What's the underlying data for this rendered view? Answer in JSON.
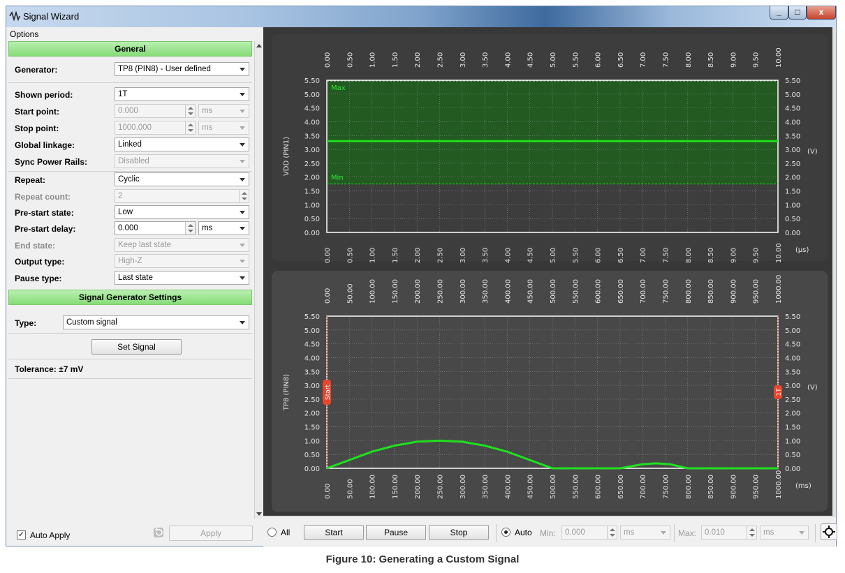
{
  "window": {
    "title": "Signal Wizard"
  },
  "menu": {
    "options": "Options"
  },
  "general": {
    "header": "General",
    "generator_label": "Generator:",
    "generator_value": "TP8 (PIN8) - User defined",
    "shown_period_label": "Shown period:",
    "shown_period_value": "1T",
    "start_point_label": "Start point:",
    "start_point_value": "0.000",
    "start_point_unit": "ms",
    "stop_point_label": "Stop point:",
    "stop_point_value": "1000.000",
    "stop_point_unit": "ms",
    "global_linkage_label": "Global linkage:",
    "global_linkage_value": "Linked",
    "sync_power_rails_label": "Sync Power Rails:",
    "sync_power_rails_value": "Disabled",
    "repeat_label": "Repeat:",
    "repeat_value": "Cyclic",
    "repeat_count_label": "Repeat count:",
    "repeat_count_value": "2",
    "prestart_state_label": "Pre-start state:",
    "prestart_state_value": "Low",
    "prestart_delay_label": "Pre-start delay:",
    "prestart_delay_value": "0.000",
    "prestart_delay_unit": "ms",
    "end_state_label": "End state:",
    "end_state_value": "Keep last state",
    "output_type_label": "Output type:",
    "output_type_value": "High-Z",
    "pause_type_label": "Pause type:",
    "pause_type_value": "Last state"
  },
  "sgs": {
    "header": "Signal Generator Settings",
    "type_label": "Type:",
    "type_value": "Custom signal",
    "set_signal": "Set Signal",
    "tolerance": "Tolerance: ±7 mV"
  },
  "bottom_left": {
    "auto_apply": "Auto Apply",
    "apply": "Apply",
    "check_mark": "✓"
  },
  "controls": {
    "all": "All",
    "start": "Start",
    "pause": "Pause",
    "stop": "Stop",
    "auto": "Auto",
    "min_label": "Min:",
    "min_value": "0.000",
    "min_unit": "ms",
    "max_label": "Max:",
    "max_value": "0.010",
    "max_unit": "ms"
  },
  "caption": "Figure 10: Generating a Custom Signal",
  "chart_data": [
    {
      "type": "line",
      "ylabel": "VDD (PIN1)",
      "yunit": "(V)",
      "xunit": "(µs)",
      "x_ticks": [
        "0.00",
        "0.50",
        "1.00",
        "1.50",
        "2.00",
        "2.50",
        "3.00",
        "3.50",
        "4.00",
        "4.50",
        "5.00",
        "5.50",
        "6.00",
        "6.50",
        "7.00",
        "7.50",
        "8.00",
        "8.50",
        "9.00",
        "9.50",
        "10.00"
      ],
      "y_ticks": [
        "0.00",
        "0.50",
        "1.00",
        "1.50",
        "2.00",
        "2.50",
        "3.00",
        "3.50",
        "4.00",
        "4.50",
        "5.00",
        "5.50"
      ],
      "xlim": [
        0,
        10
      ],
      "ylim": [
        0,
        5.5
      ],
      "max_label": "Max",
      "min_label": "Min",
      "max_value": 5.5,
      "min_value": 1.75,
      "series": [
        {
          "x": [
            0,
            10
          ],
          "y": [
            3.3,
            3.3
          ]
        }
      ],
      "colors": {
        "line": "#1fe01f",
        "band": "#1f5d1f"
      }
    },
    {
      "type": "line",
      "ylabel": "TP8 (PIN8)",
      "yunit": "(V)",
      "xunit": "(ms)",
      "x_ticks": [
        "0.00",
        "50.00",
        "100.00",
        "150.00",
        "200.00",
        "250.00",
        "300.00",
        "350.00",
        "400.00",
        "450.00",
        "500.00",
        "550.00",
        "600.00",
        "650.00",
        "700.00",
        "750.00",
        "800.00",
        "850.00",
        "900.00",
        "950.00",
        "1000.00"
      ],
      "y_ticks": [
        "0.00",
        "0.50",
        "1.00",
        "1.50",
        "2.00",
        "2.50",
        "3.00",
        "3.50",
        "4.00",
        "4.50",
        "5.00",
        "5.50"
      ],
      "xlim": [
        0,
        1000
      ],
      "ylim": [
        0,
        5.5
      ],
      "start_marker": "Start",
      "end_marker": "1T",
      "series": [
        {
          "x": [
            0,
            50,
            100,
            150,
            200,
            250,
            300,
            350,
            400,
            450,
            500,
            550,
            600,
            650,
            700,
            730,
            760,
            800,
            850,
            900,
            950,
            1000
          ],
          "y": [
            0,
            0.3,
            0.6,
            0.82,
            0.96,
            1.0,
            0.96,
            0.82,
            0.6,
            0.3,
            0,
            0,
            0,
            0,
            0.15,
            0.18,
            0.15,
            0,
            0,
            0,
            0,
            0
          ]
        }
      ],
      "colors": {
        "line": "#1fe01f",
        "marker": "#e8452c"
      }
    }
  ]
}
